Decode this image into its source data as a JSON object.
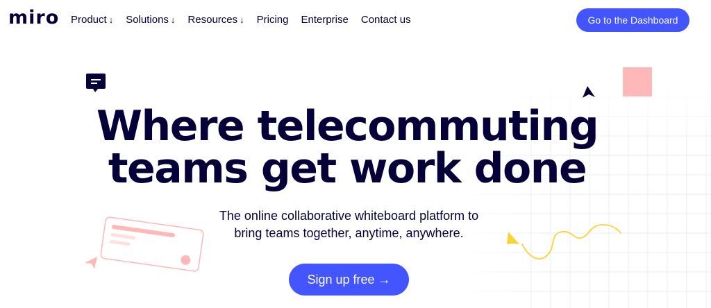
{
  "header": {
    "logo": "miro",
    "nav": [
      {
        "label": "Product",
        "caret": "↓"
      },
      {
        "label": "Solutions",
        "caret": "↓"
      },
      {
        "label": "Resources",
        "caret": "↓"
      },
      {
        "label": "Pricing",
        "caret": ""
      },
      {
        "label": "Enterprise",
        "caret": ""
      },
      {
        "label": "Contact us",
        "caret": ""
      }
    ],
    "cta_label": "Go to the Dashboard"
  },
  "hero": {
    "title_line1": "Where telecommuting",
    "title_line2": "teams get work done",
    "subtitle_line1": "The online collaborative whiteboard platform to",
    "subtitle_line2": "bring teams together, anytime, anywhere.",
    "signup_label": "Sign up free →"
  },
  "colors": {
    "brand_blue": "#4255ff",
    "ink": "#050038",
    "pink": "#ffb8b8",
    "yellow": "#fdd235"
  },
  "icons": [
    "comment-icon",
    "cursor-arrow-icon",
    "sticky-note-shape",
    "card-shape",
    "squiggle-line"
  ]
}
